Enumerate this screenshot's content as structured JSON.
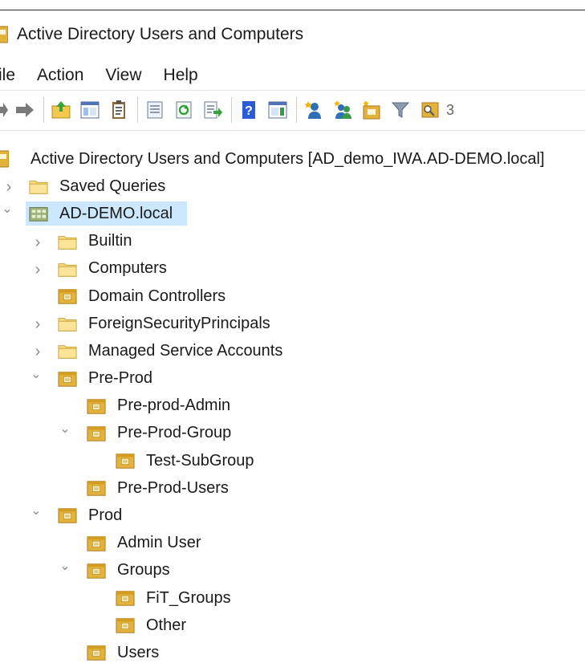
{
  "window": {
    "title": "Active Directory Users and Computers",
    "icon": "ad-console-icon"
  },
  "menu": [
    "ile",
    "Action",
    "View",
    "Help"
  ],
  "toolbar": {
    "buttons": [
      "back-arrow-icon",
      "forward-arrow-icon",
      "up-folder-icon",
      "show-console-tree-icon",
      "clipboard-icon",
      "properties-icon",
      "refresh-icon",
      "export-list-icon",
      "help-icon",
      "action-pane-icon",
      "new-user-icon",
      "new-group-icon",
      "new-ou-icon",
      "filter-icon",
      "find-icon",
      "more-icon"
    ]
  },
  "tree": {
    "root_label": "Active Directory Users and Computers [AD_demo_IWA.AD-DEMO.local]",
    "nodes": [
      {
        "label": "Saved Queries",
        "level": 1,
        "expander": ">",
        "icon": "folder-icon"
      },
      {
        "label": "AD-DEMO.local",
        "level": 1,
        "expander": "v",
        "icon": "domain-icon",
        "selected": true
      },
      {
        "label": "Builtin",
        "level": 2,
        "expander": ">",
        "icon": "folder-icon"
      },
      {
        "label": "Computers",
        "level": 2,
        "expander": ">",
        "icon": "folder-icon"
      },
      {
        "label": "Domain Controllers",
        "level": 2,
        "expander": "",
        "icon": "ou-icon"
      },
      {
        "label": "ForeignSecurityPrincipals",
        "level": 2,
        "expander": ">",
        "icon": "folder-icon"
      },
      {
        "label": "Managed Service Accounts",
        "level": 2,
        "expander": ">",
        "icon": "folder-icon"
      },
      {
        "label": "Pre-Prod",
        "level": 2,
        "expander": "v",
        "icon": "ou-icon"
      },
      {
        "label": "Pre-prod-Admin",
        "level": 3,
        "expander": "",
        "icon": "ou-icon"
      },
      {
        "label": "Pre-Prod-Group",
        "level": 3,
        "expander": "v",
        "icon": "ou-icon"
      },
      {
        "label": "Test-SubGroup",
        "level": 4,
        "expander": "",
        "icon": "ou-icon"
      },
      {
        "label": "Pre-Prod-Users",
        "level": 3,
        "expander": "",
        "icon": "ou-icon"
      },
      {
        "label": "Prod",
        "level": 2,
        "expander": "v",
        "icon": "ou-icon"
      },
      {
        "label": "Admin User",
        "level": 3,
        "expander": "",
        "icon": "ou-icon"
      },
      {
        "label": "Groups",
        "level": 3,
        "expander": "v",
        "icon": "ou-icon"
      },
      {
        "label": "FiT_Groups",
        "level": 4,
        "expander": "",
        "icon": "ou-icon"
      },
      {
        "label": "Other",
        "level": 4,
        "expander": "",
        "icon": "ou-icon"
      },
      {
        "label": "Users",
        "level": 3,
        "expander": "",
        "icon": "ou-icon"
      }
    ]
  },
  "colors": {
    "selection": "#cce8ff",
    "folder": "#f6d87a",
    "ou_folder": "#e3b23c",
    "arrow": "#8a8a8a"
  }
}
